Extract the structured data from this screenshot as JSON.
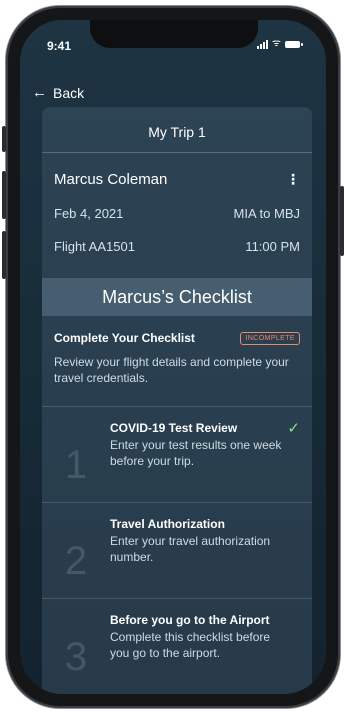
{
  "status": {
    "time": "9:41"
  },
  "nav": {
    "back_label": "Back"
  },
  "trip": {
    "title": "My Trip 1",
    "passenger": "Marcus Coleman",
    "date": "Feb 4, 2021",
    "route": "MIA to MBJ",
    "flight": "Flight AA1501",
    "time": "11:00 PM"
  },
  "checklist": {
    "header": "Marcus’s Checklist",
    "title": "Complete Your Checklist",
    "status_badge": "INCOMPLETE",
    "description": "Review your flight details and complete your travel credentials.",
    "items": [
      {
        "number": "1",
        "title": "COVID-19 Test Review",
        "subtitle": "Enter your test results one week before your trip.",
        "completed": true
      },
      {
        "number": "2",
        "title": "Travel Authorization",
        "subtitle": "Enter your travel authorization number.",
        "completed": false
      },
      {
        "number": "3",
        "title": "Before you go to the Airport",
        "subtitle": "Complete this checklist before you go to the airport.",
        "completed": false
      }
    ]
  },
  "colors": {
    "badge_incomplete": "#e8896a",
    "checkmark": "#8ee083",
    "background_top": "#1f3443",
    "background_bottom": "#13222e"
  }
}
